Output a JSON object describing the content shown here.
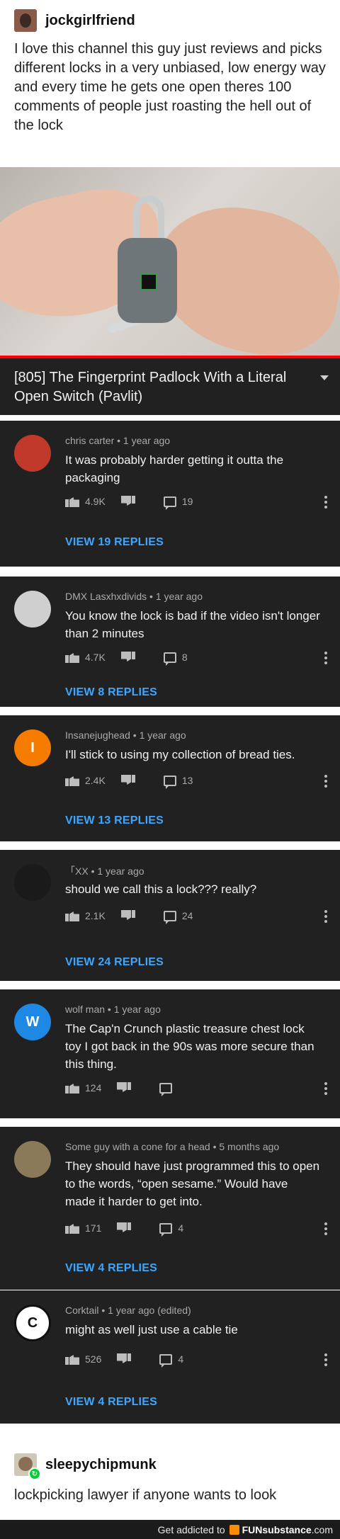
{
  "post": {
    "username": "jockgirlfriend",
    "text": "I love this channel this guy just reviews and picks different locks in a very unbiased, low energy way and every time he gets one open theres 100 comments of people just roasting the hell out of the lock"
  },
  "video": {
    "title": "[805] The Fingerprint Padlock With a Literal Open Switch (Pavlit)",
    "progress_fraction": 1.0,
    "progress_color": "#ff0000"
  },
  "comments": [
    {
      "author": "chris carter",
      "age": "1 year ago",
      "text": "It was probably harder getting it outta the packaging",
      "likes": "4.9K",
      "replies": "19",
      "view_replies": "VIEW 19 REPLIES",
      "avatar_color": "#c0392b",
      "avatar_letter": ""
    },
    {
      "author": "DMX Lasxhxdivids",
      "age": "1 year ago",
      "text": "You know the lock is bad if the video isn't longer than 2 minutes",
      "likes": "4.7K",
      "replies": "8",
      "view_replies": "VIEW 8 REPLIES",
      "avatar_color": "#cfcfcf",
      "avatar_letter": ""
    },
    {
      "author": "Insanejughead",
      "age": "1 year ago",
      "text": "I'll stick to using my collection of bread ties.",
      "likes": "2.4K",
      "replies": "13",
      "view_replies": "VIEW 13 REPLIES",
      "avatar_color": "#f57c00",
      "avatar_letter": "I"
    },
    {
      "author": "「XX",
      "age": "1 year ago",
      "text": "should we call this a lock??? really?",
      "likes": "2.1K",
      "replies": "24",
      "view_replies": "VIEW 24 REPLIES",
      "avatar_color": "#1a1a1a",
      "avatar_letter": ""
    },
    {
      "author": "wolf man",
      "age": "1 year ago",
      "text": "The Cap'n Crunch plastic treasure chest lock toy I got back in the 90s was more secure than this thing.",
      "likes": "124",
      "replies": "",
      "view_replies": "",
      "avatar_color": "#1e88e5",
      "avatar_letter": "W"
    },
    {
      "author": "Some guy with a cone for a head",
      "age": "5 months ago",
      "text": "They should have just programmed this to open to the words, “open sesame.” Would have made it harder to get into.",
      "likes": "171",
      "replies": "4",
      "view_replies": "VIEW 4 REPLIES",
      "avatar_color": "#8a7a5a",
      "avatar_letter": ""
    },
    {
      "author": "Corktail",
      "age": "1 year ago (edited)",
      "text": "might as well just use a cable tie",
      "likes": "526",
      "replies": "4",
      "view_replies": "VIEW 4 REPLIES",
      "avatar_color": "#ffffff",
      "avatar_letter": "C"
    }
  ],
  "reblog": {
    "username": "sleepychipmunk",
    "text": "lockpicking lawyer if anyone wants to look"
  },
  "footer": {
    "prefix": "Get addicted to",
    "brand": "FUNsubstance",
    "suffix": ".com"
  },
  "icons": [
    "thumbs-up-icon",
    "thumbs-down-icon",
    "reply-icon",
    "more-vert-icon",
    "chevron-down-icon",
    "reblog-icon"
  ]
}
